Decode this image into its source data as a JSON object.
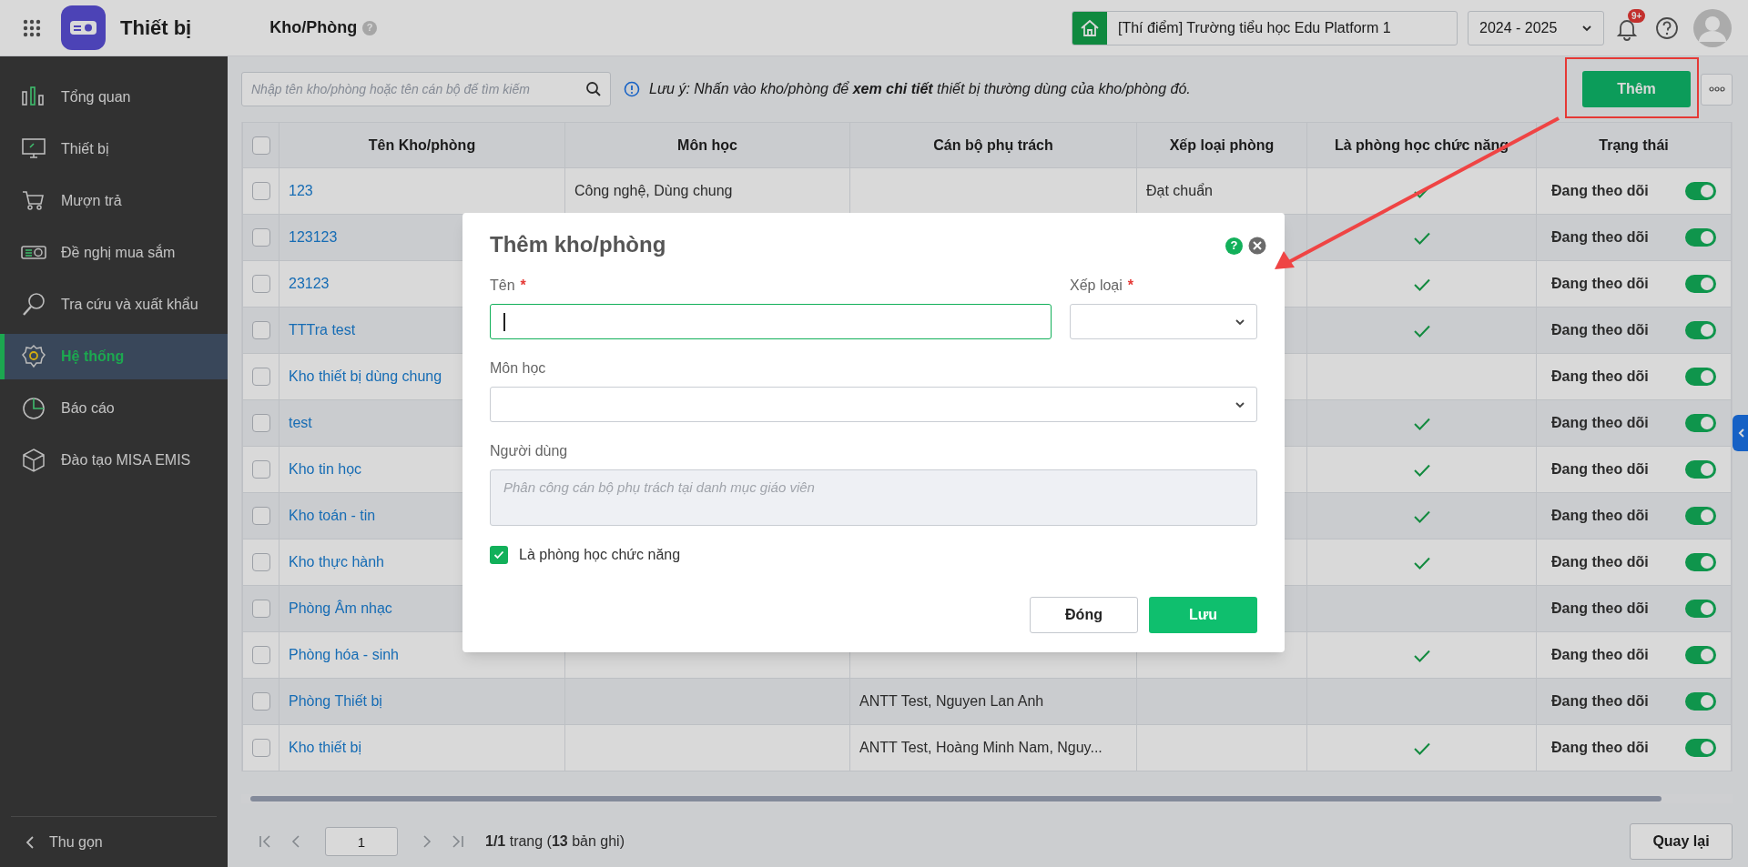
{
  "app": {
    "title": "Thiết bị"
  },
  "page": {
    "title": "Kho/Phòng",
    "help": "?"
  },
  "school": "[Thí điểm] Trường tiểu học Edu Platform 1",
  "year": "2024 - 2025",
  "notifications": "9+",
  "sidebar": {
    "items": [
      {
        "label": "Tổng quan",
        "selected": false
      },
      {
        "label": "Thiết bị",
        "selected": false
      },
      {
        "label": "Mượn trả",
        "selected": false
      },
      {
        "label": "Đề nghị mua sắm",
        "selected": false
      },
      {
        "label": "Tra cứu và xuất khẩu",
        "selected": false
      },
      {
        "label": "Hệ thống",
        "selected": true
      },
      {
        "label": "Báo cáo",
        "selected": false
      },
      {
        "label": "Đào tạo MISA EMIS",
        "selected": false
      }
    ],
    "collapse": "Thu gọn"
  },
  "toolbar": {
    "search_placeholder": "Nhập tên kho/phòng hoặc tên cán bộ để tìm kiếm",
    "note": "Lưu ý: Nhấn vào kho/phòng để **xem chi tiết** thiết bị thường dùng của kho/phòng đó.",
    "add_button": "Thêm"
  },
  "table": {
    "columns": [
      "Tên Kho/phòng",
      "Môn học",
      "Cán bộ phụ trách",
      "Xếp loại phòng",
      "Là phòng học chức năng",
      "Trạng thái"
    ],
    "select_all_checked": false,
    "rows": [
      {
        "checked": false,
        "name": "123",
        "subject": "Công nghệ, Dùng chung",
        "classification": "Đạt chuẩn",
        "functional": true,
        "status": "Đang theo dõi",
        "on": true
      },
      {
        "checked": false,
        "name": "123123",
        "functional": true,
        "status": "Đang theo dõi",
        "on": true
      },
      {
        "checked": false,
        "name": "23123",
        "functional": true,
        "status": "Đang theo dõi",
        "on": true
      },
      {
        "checked": false,
        "name": "TTTra test",
        "functional": true,
        "status": "Đang theo dõi",
        "on": true
      },
      {
        "checked": false,
        "name": "Kho thiết bị dùng chung",
        "functional": false,
        "status": "Đang theo dõi",
        "on": true
      },
      {
        "checked": false,
        "name": "test",
        "functional": true,
        "status": "Đang theo dõi",
        "on": true
      },
      {
        "checked": false,
        "name": "Kho tin học",
        "functional": true,
        "status": "Đang theo dõi",
        "on": true
      },
      {
        "checked": false,
        "name": "Kho toán - tin",
        "functional": true,
        "status": "Đang theo dõi",
        "on": true
      },
      {
        "checked": false,
        "name": "Kho thực hành",
        "functional": true,
        "status": "Đang theo dõi",
        "on": true
      },
      {
        "checked": false,
        "name": "Phòng Âm nhạc",
        "functional": false,
        "status": "Đang theo dõi",
        "on": true
      },
      {
        "checked": false,
        "name": "Phòng hóa - sinh",
        "functional": true,
        "status": "Đang theo dõi",
        "on": true
      },
      {
        "checked": false,
        "name": "Phòng Thiết bị",
        "staff": "ANTT Test, Nguyen Lan Anh",
        "functional": false,
        "status": "Đang theo dõi",
        "on": true
      },
      {
        "checked": false,
        "name": "Kho thiết bị",
        "staff": "ANTT Test, Hoàng Minh Nam, Nguy...",
        "functional": true,
        "status": "Đang theo dõi",
        "on": true
      }
    ]
  },
  "pagination": {
    "page": "1",
    "summary": "**1/1** trang (**13** bản ghi)",
    "back_button": "Quay lại"
  },
  "modal": {
    "title": "Thêm kho/phòng",
    "help": "?",
    "field_rows": [
      [
        {
          "kind": "text",
          "label": "Tên",
          "mark": "*",
          "focused": true
        },
        {
          "kind": "select",
          "label": "Xếp loại",
          "mark": "*",
          "focused": false
        }
      ],
      [
        {
          "kind": "select",
          "label": "Môn học",
          "focused": false
        }
      ],
      [
        {
          "kind": "textarea",
          "label": "Người dùng",
          "placeholder": "Phân công cán bộ phụ trách tại danh mục giáo viên",
          "focused": false
        }
      ]
    ],
    "checkbox": {
      "label": "Là phòng học chức năng",
      "checked": true
    },
    "close_button": "Đóng",
    "save_button": "Lưu"
  }
}
